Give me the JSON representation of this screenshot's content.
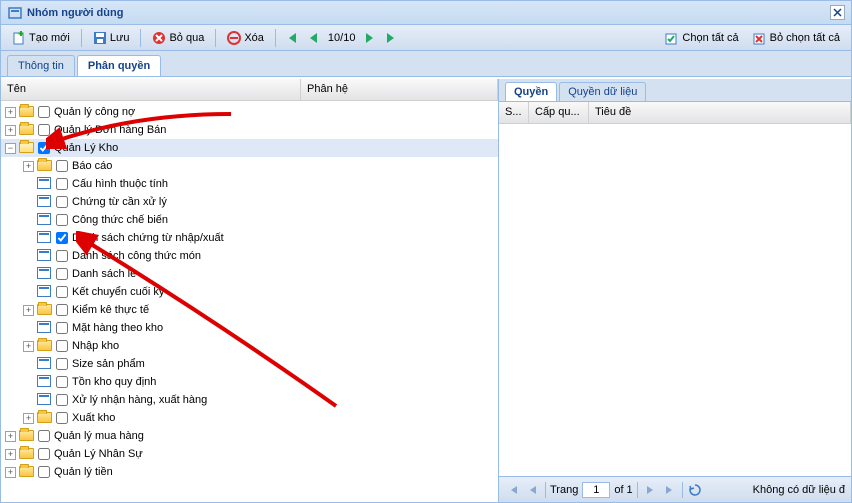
{
  "window": {
    "title": "Nhóm người dùng"
  },
  "toolbar": {
    "new": "Tạo mới",
    "save": "Lưu",
    "cancel": "Bỏ qua",
    "delete": "Xóa",
    "counter": "10/10",
    "selectAll": "Chọn tất cả",
    "deselectAll": "Bỏ chọn tất cả"
  },
  "tabs": {
    "info": "Thông tin",
    "perm": "Phân quyền"
  },
  "leftCols": {
    "name": "Tên",
    "module": "Phân hệ"
  },
  "tree": {
    "n1": "Quản lý công nợ",
    "n2": "Quản lý Đơn hàng Bán",
    "n3": "Quản Lý Kho",
    "n3c": {
      "a": "Báo cáo",
      "b": "Cấu hình thuộc tính",
      "c": "Chứng từ cần xử lý",
      "d": "Công thức chế biến",
      "e": "Danh sách chứng từ nhập/xuất",
      "f": "Danh sách công thức món",
      "g": "Danh sách lề",
      "h": "Kết chuyển cuối kỳ",
      "i": "Kiểm kê thực tế",
      "j": "Mặt hàng theo kho",
      "k": "Nhập kho",
      "l": "Size sản phẩm",
      "m": "Tồn kho quy định",
      "n": "Xử lý nhận hàng, xuất hàng",
      "o": "Xuất kho"
    },
    "n4": "Quản lý mua hàng",
    "n5": "Quản Lý Nhân Sự",
    "n6": "Quản lý tiền"
  },
  "rightTabs": {
    "perm": "Quyền",
    "dataPerm": "Quyền dữ liệu"
  },
  "rightCols": {
    "c1": "S...",
    "c2": "Cấp qu...",
    "c3": "Tiêu đề"
  },
  "pager": {
    "page": "Trang",
    "pageNum": "1",
    "of": "of 1",
    "nodata": "Không có dữ liệu đ"
  }
}
